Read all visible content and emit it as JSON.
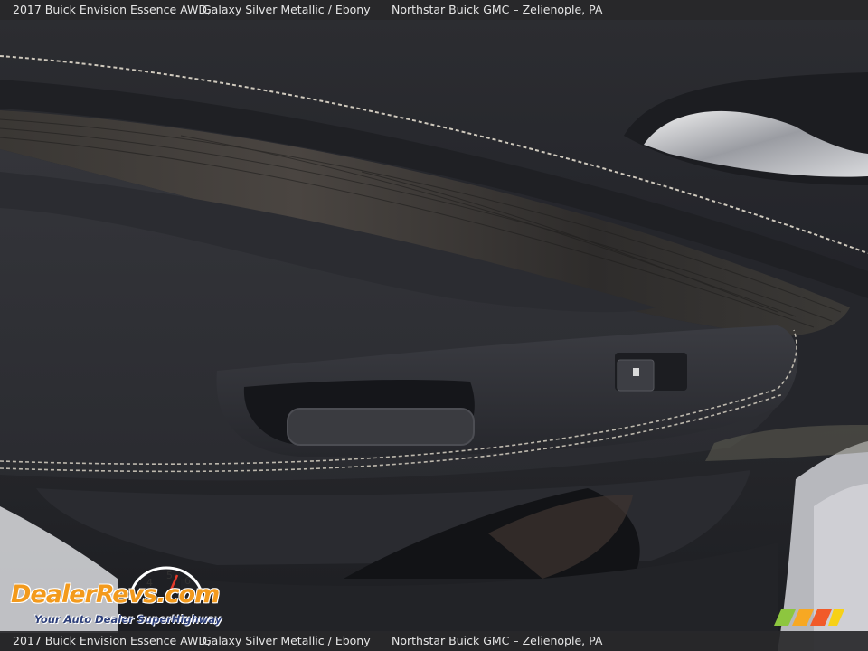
{
  "caption": {
    "vehicle": "2017 Buick Envision Essence AWD,",
    "color": "Galaxy Silver Metallic / Ebony",
    "dealer": "Northstar Buick GMC – Zelienople, PA"
  },
  "watermark": {
    "brand": "DealerRevs.com",
    "tagline": "Your Auto Dealer SuperHighway",
    "gauge_numbers": [
      "4",
      "5",
      "6"
    ]
  },
  "colors": {
    "caption_bar": "#28282a",
    "logo_orange": "#f39a1c",
    "logo_blue": "#2d4fa2",
    "stripe_colors": [
      "#8dc63f",
      "#f7a823",
      "#f15a29"
    ]
  }
}
